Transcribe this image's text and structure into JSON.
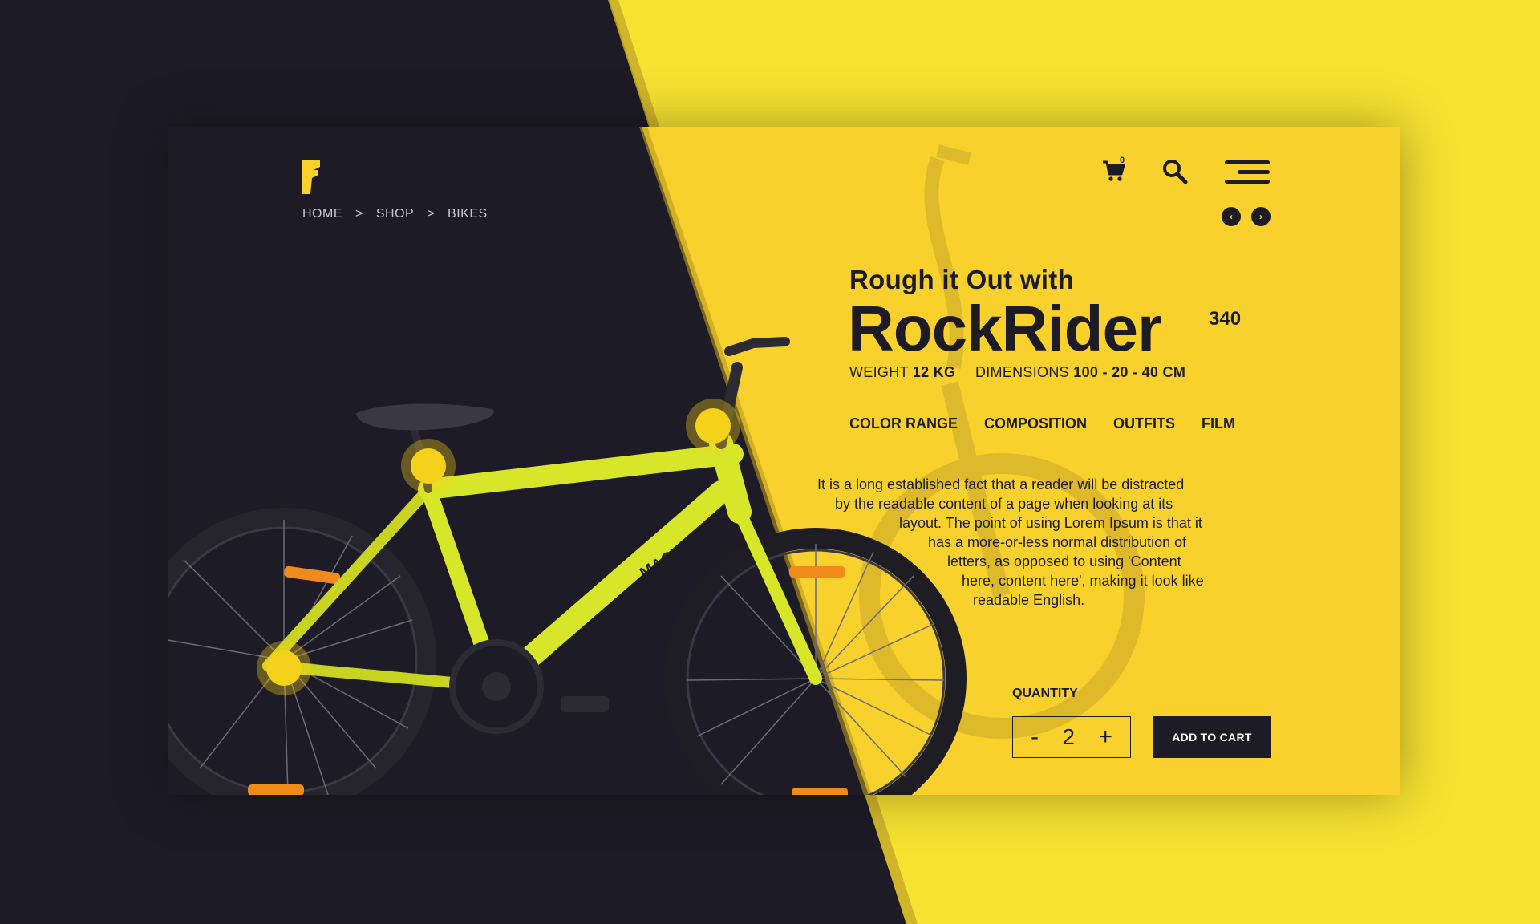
{
  "header": {
    "logo_icon": "lightning-f-logo",
    "breadcrumb": [
      "HOME",
      "SHOP",
      "BIKES"
    ],
    "breadcrumb_separator": ">",
    "cart_count": "0",
    "icons": [
      "cart-icon",
      "search-icon",
      "menu-icon",
      "chevron-left-icon",
      "chevron-right-icon"
    ]
  },
  "nav_arrows": {
    "prev": "‹",
    "next": "›"
  },
  "product": {
    "subtitle": "Rough it Out with",
    "name": "RockRider",
    "model": "340",
    "weight_label": "WEIGHT",
    "weight_value": "12 KG",
    "dimensions_label": "DIMENSIONS",
    "dimensions_value": "100 - 20 - 40 CM",
    "frame_text": "MACH CITY"
  },
  "tabs": [
    "COLOR RANGE",
    "COMPOSITION",
    "OUTFITS",
    "FILM"
  ],
  "description_lines": [
    "It is a long established fact that a reader will be distracted",
    "by the readable content of a page when looking at its",
    "layout. The point of using Lorem Ipsum is that it",
    "has a more-or-less normal distribution of",
    "letters, as opposed to using 'Content",
    "here, content here', making it look like",
    "readable English."
  ],
  "purchase": {
    "quantity_label": "QUANTITY",
    "minus": "-",
    "quantity_value": "2",
    "plus": "+",
    "add_to_cart": "ADD TO CART"
  },
  "colors": {
    "dark": "#1d1b26",
    "yellow": "#f9d12c",
    "bright_yellow": "#f6e231",
    "frame": "#d8e62a",
    "hotspot": "#f5d21a"
  }
}
